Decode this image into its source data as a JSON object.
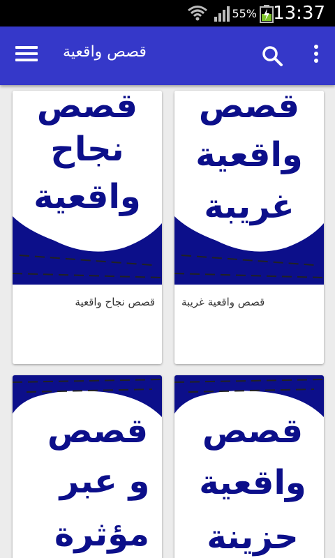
{
  "status": {
    "battery_pct": "55%",
    "time": "13:37"
  },
  "app_bar": {
    "title": "قصص واقعية"
  },
  "cards": [
    {
      "caption": "قصص نجاح واقعية",
      "thumb_lines": [
        "قصص",
        "نجاح",
        "واقعية"
      ]
    },
    {
      "caption": "قصص واقعية غريبة",
      "thumb_lines": [
        "قصص",
        "واقعية",
        "غريبة"
      ]
    },
    {
      "caption": "",
      "thumb_lines": [
        "قصص",
        "و عبر",
        "مؤثرة"
      ]
    },
    {
      "caption": "",
      "thumb_lines": [
        "قصص",
        "واقعية",
        "حزينة"
      ]
    }
  ],
  "colors": {
    "app_bar": "#3538c9",
    "thumb_blue": "#0c0f8a",
    "background": "#ececec"
  }
}
